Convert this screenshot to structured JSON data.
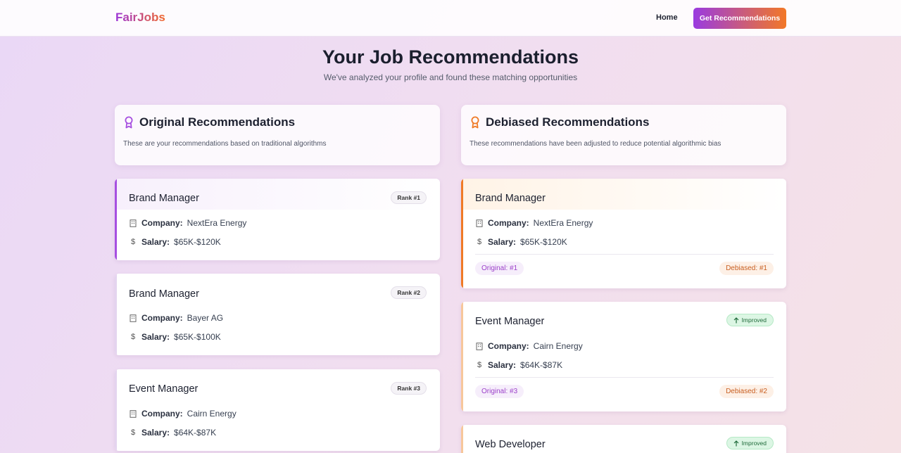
{
  "app": {
    "brand": "FairJobs",
    "nav_home": "Home",
    "nav_cta": "Get Recommendations"
  },
  "page": {
    "title": "Your Job Recommendations",
    "subtitle": "We've analyzed your profile and found these matching opportunities"
  },
  "original": {
    "title": "Original Recommendations",
    "description": "These are your recommendations based on traditional algorithms",
    "jobs": [
      {
        "title": "Brand Manager",
        "rank": "Rank #1",
        "company_label": "Company:",
        "company": "NextEra Energy",
        "salary_label": "Salary:",
        "salary": "$65K-$120K"
      },
      {
        "title": "Brand Manager",
        "rank": "Rank #2",
        "company_label": "Company:",
        "company": "Bayer AG",
        "salary_label": "Salary:",
        "salary": "$65K-$100K"
      },
      {
        "title": "Event Manager",
        "rank": "Rank #3",
        "company_label": "Company:",
        "company": "Cairn Energy",
        "salary_label": "Salary:",
        "salary": "$64K-$87K"
      }
    ]
  },
  "debiased": {
    "title": "Debiased Recommendations",
    "description": "These recommendations have been adjusted to reduce potential algorithmic bias",
    "jobs": [
      {
        "title": "Brand Manager",
        "company_label": "Company:",
        "company": "NextEra Energy",
        "salary_label": "Salary:",
        "salary": "$65K-$120K",
        "original": "Original: #1",
        "debiased": "Debiased: #1"
      },
      {
        "title": "Event Manager",
        "badge": "Improved",
        "company_label": "Company:",
        "company": "Cairn Energy",
        "salary_label": "Salary:",
        "salary": "$64K-$87K",
        "original": "Original: #3",
        "debiased": "Debiased: #2"
      },
      {
        "title": "Web Developer",
        "badge": "Improved"
      }
    ]
  },
  "colors": {
    "original_accent": "#a64fe0",
    "debiased_accent": "#ef7a26",
    "debiased_accent_soft": "#f7c79b"
  }
}
